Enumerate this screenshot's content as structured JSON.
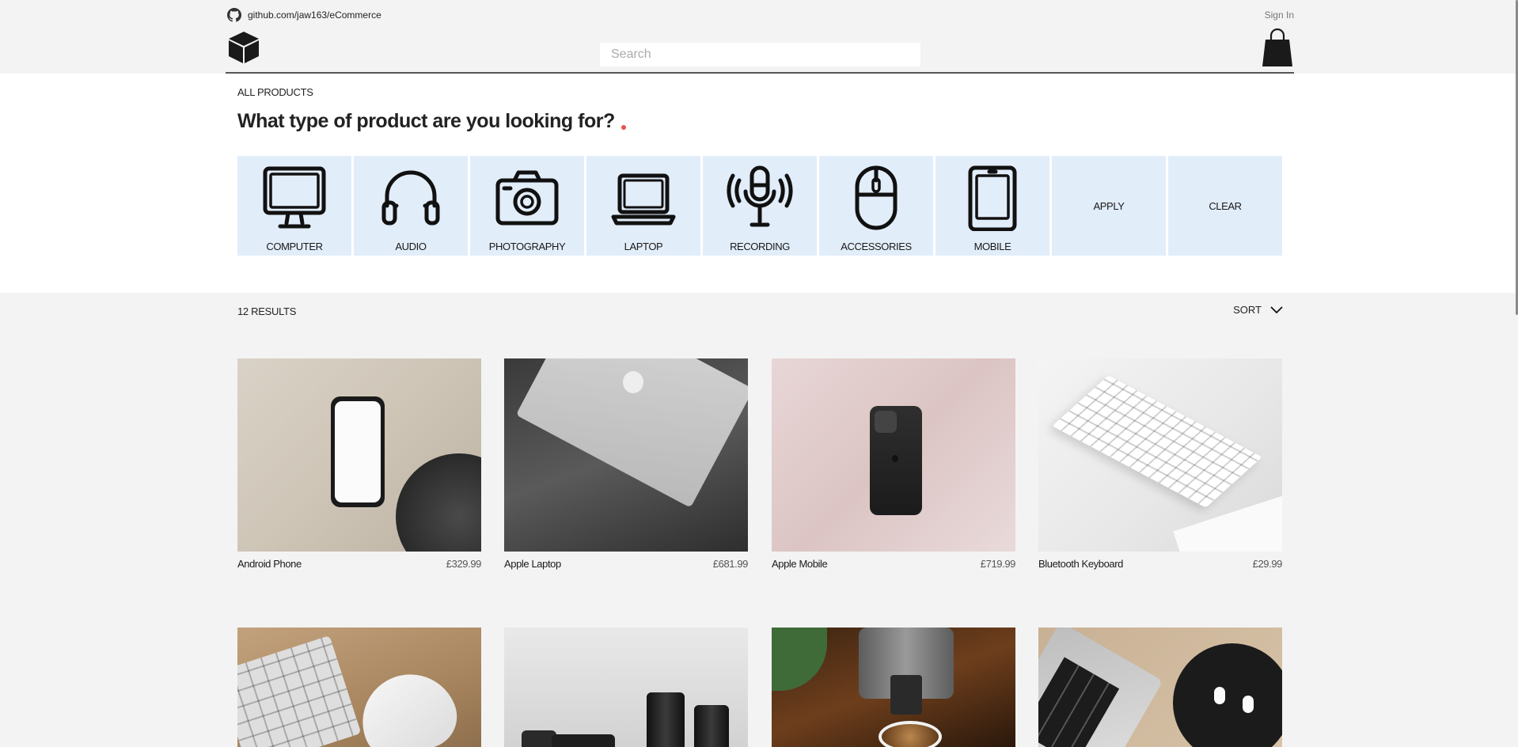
{
  "header": {
    "repo_link": "github.com/jaw163/eCommerce",
    "signin_label": "Sign In",
    "search_placeholder": "Search"
  },
  "filter": {
    "breadcrumb": "ALL PRODUCTS",
    "question": "What type of product are you looking for?",
    "categories": [
      {
        "label": "COMPUTER",
        "icon": "computer-icon"
      },
      {
        "label": "AUDIO",
        "icon": "headphones-icon"
      },
      {
        "label": "PHOTOGRAPHY",
        "icon": "camera-icon"
      },
      {
        "label": "LAPTOP",
        "icon": "laptop-icon"
      },
      {
        "label": "RECORDING",
        "icon": "microphone-icon"
      },
      {
        "label": "ACCESSORIES",
        "icon": "mouse-icon"
      },
      {
        "label": "MOBILE",
        "icon": "mobile-icon"
      }
    ],
    "apply_label": "APPLY",
    "clear_label": "CLEAR",
    "tile_color": "#e2edfa"
  },
  "results": {
    "count_label": "12 RESULTS",
    "sort_label": "SORT"
  },
  "products": [
    {
      "name": "Android Phone",
      "price": "£329.99"
    },
    {
      "name": "Apple Laptop",
      "price": "£681.99"
    },
    {
      "name": "Apple Mobile",
      "price": "£719.99"
    },
    {
      "name": "Bluetooth Keyboard",
      "price": "£29.99"
    },
    {
      "name": "",
      "price": ""
    },
    {
      "name": "",
      "price": ""
    },
    {
      "name": "",
      "price": ""
    },
    {
      "name": "",
      "price": ""
    }
  ]
}
